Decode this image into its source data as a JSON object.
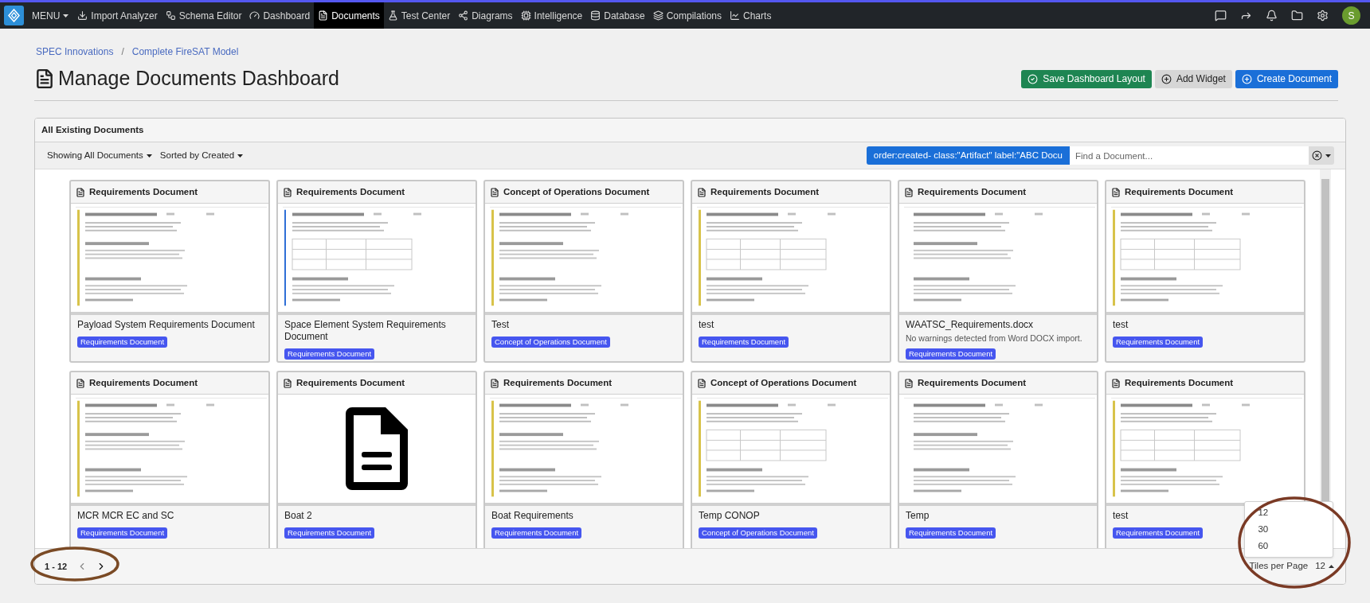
{
  "nav": {
    "menu": "MENU",
    "items": [
      {
        "label": "Import Analyzer",
        "selected": false
      },
      {
        "label": "Schema Editor",
        "selected": false
      },
      {
        "label": "Dashboard",
        "selected": false
      },
      {
        "label": "Documents",
        "selected": true
      },
      {
        "label": "Test Center",
        "selected": false
      },
      {
        "label": "Diagrams",
        "selected": false
      },
      {
        "label": "Intelligence",
        "selected": false
      },
      {
        "label": "Database",
        "selected": false
      },
      {
        "label": "Compilations",
        "selected": false
      },
      {
        "label": "Charts",
        "selected": false
      }
    ],
    "avatar": "S"
  },
  "breadcrumb": [
    "SPEC Innovations",
    "Complete FireSAT Model"
  ],
  "breadcrumb_separator": "/",
  "page_title": "Manage Documents Dashboard",
  "actions": [
    {
      "label": "Save Dashboard Layout",
      "kind": "success"
    },
    {
      "label": "Add Widget",
      "kind": "secondary"
    },
    {
      "label": "Create Document",
      "kind": "primary"
    }
  ],
  "panel": {
    "title": "All Existing Documents",
    "filter": "Showing All Documents",
    "sort": "Sorted by Created",
    "query": "order:created- class:\"Artifact\" label:\"ABC Docu",
    "search_placeholder": "Find a Document...",
    "documents": [
      {
        "type": "Requirements Document",
        "name": "Payload System Requirements Document",
        "badge": "Requirements Document",
        "kind": "page"
      },
      {
        "type": "Requirements Document",
        "name": "Space Element System Requirements Document",
        "badge": "Requirements Document",
        "kind": "page"
      },
      {
        "type": "Concept of Operations Document",
        "name": "Test",
        "badge": "Concept of Operations Document",
        "kind": "page"
      },
      {
        "type": "Requirements Document",
        "name": "test",
        "badge": "Requirements Document",
        "kind": "page"
      },
      {
        "type": "Requirements Document",
        "name": "WAATSC_Requirements.docx",
        "note": "No warnings detected from Word DOCX import.",
        "badge": "Requirements Document",
        "kind": "page"
      },
      {
        "type": "Requirements Document",
        "name": "test",
        "badge": "Requirements Document",
        "kind": "page"
      },
      {
        "type": "Requirements Document",
        "name": "MCR MCR EC and SC",
        "badge": "Requirements Document",
        "kind": "page"
      },
      {
        "type": "Requirements Document",
        "name": "Boat 2",
        "badge": "Requirements Document",
        "kind": "icon"
      },
      {
        "type": "Requirements Document",
        "name": "Boat Requirements",
        "badge": "Requirements Document",
        "kind": "page"
      },
      {
        "type": "Concept of Operations Document",
        "name": "Temp CONOP",
        "badge": "Concept of Operations Document",
        "kind": "page"
      },
      {
        "type": "Requirements Document",
        "name": "Temp",
        "badge": "Requirements Document",
        "kind": "page"
      },
      {
        "type": "Requirements Document",
        "name": "test",
        "badge": "Requirements Document",
        "kind": "page"
      }
    ],
    "range": "1 - 12",
    "tiles_label": "Tiles per Page",
    "tiles_value": "12",
    "tiles_options": [
      {
        "label": "12",
        "selected": false
      },
      {
        "label": "30",
        "selected": false
      },
      {
        "label": "60",
        "selected": false
      }
    ]
  }
}
